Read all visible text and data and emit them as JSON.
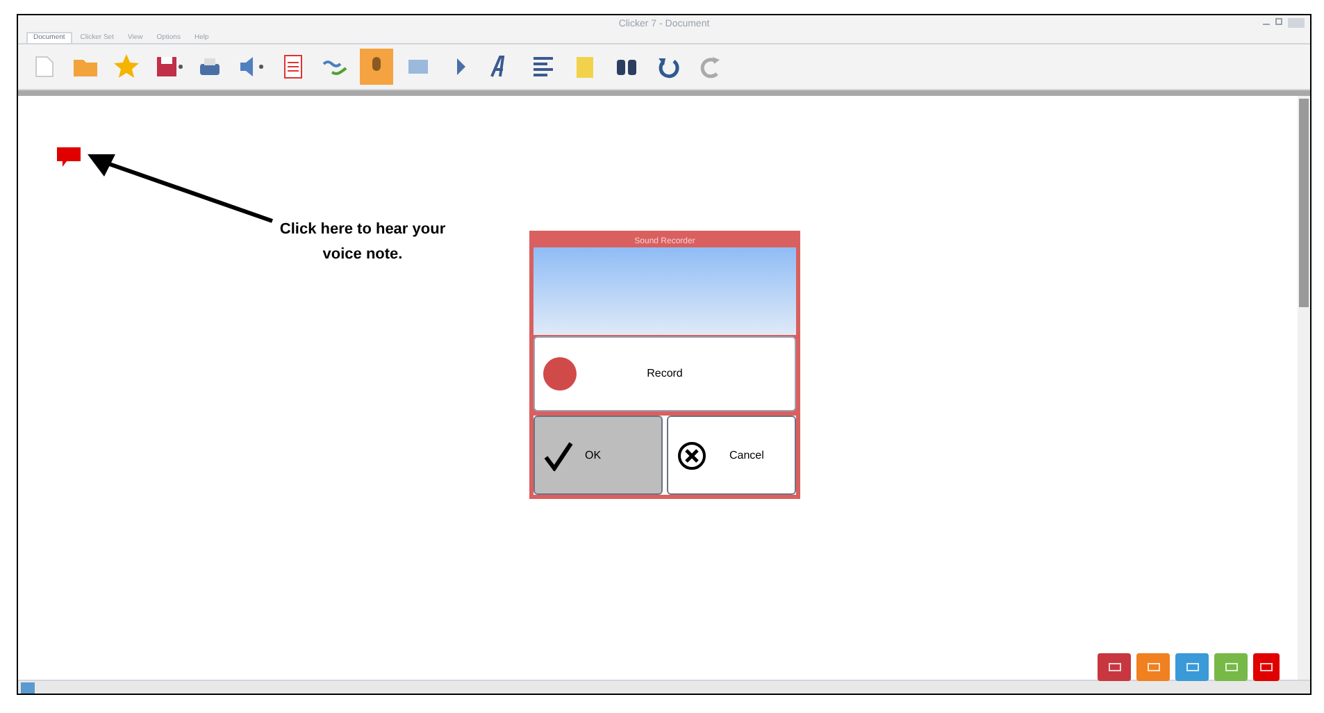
{
  "window": {
    "title": "Clicker 7 - Document"
  },
  "tabs": [
    {
      "label": "Document",
      "selected": true
    },
    {
      "label": "Clicker Set",
      "selected": false
    },
    {
      "label": "View",
      "selected": false
    },
    {
      "label": "Options",
      "selected": false
    },
    {
      "label": "Help",
      "selected": false
    }
  ],
  "toolbar": [
    {
      "kind": "new",
      "selected": false
    },
    {
      "kind": "open",
      "selected": false
    },
    {
      "kind": "star",
      "selected": false
    },
    {
      "kind": "save",
      "selected": false
    },
    {
      "kind": "print",
      "selected": false
    },
    {
      "kind": "speaker",
      "selected": false
    },
    {
      "kind": "list",
      "selected": false
    },
    {
      "kind": "check",
      "selected": false
    },
    {
      "kind": "mic",
      "selected": true
    },
    {
      "kind": "picture",
      "selected": false
    },
    {
      "kind": "pointer",
      "selected": false
    },
    {
      "kind": "font",
      "selected": false
    },
    {
      "kind": "align",
      "selected": false
    },
    {
      "kind": "note",
      "selected": false
    },
    {
      "kind": "find",
      "selected": false
    },
    {
      "kind": "undo",
      "selected": false
    },
    {
      "kind": "redo",
      "selected": false
    }
  ],
  "annotation": {
    "text": "Click here to hear your voice note."
  },
  "dialog": {
    "title": "Sound Recorder",
    "record_label": "Record",
    "buttons": [
      {
        "kind": "ok",
        "label": "OK",
        "selected": true
      },
      {
        "kind": "cancel",
        "label": "Cancel",
        "selected": false
      }
    ]
  },
  "corner_buttons": [
    {
      "color": "#c8373f"
    },
    {
      "color": "#f08020"
    },
    {
      "color": "#3a9ad8"
    },
    {
      "color": "#76b947"
    },
    {
      "color": "#e00000"
    }
  ]
}
